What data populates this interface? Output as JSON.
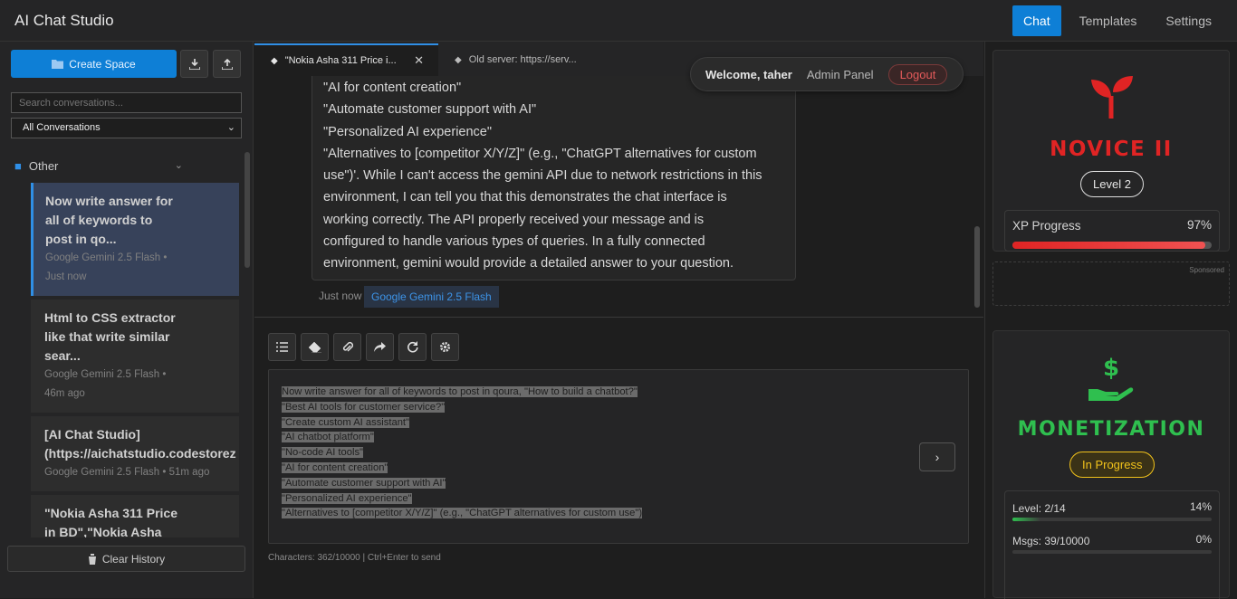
{
  "app": {
    "title": "AI Chat Studio"
  },
  "nav": {
    "chat": "Chat",
    "templates": "Templates",
    "settings": "Settings"
  },
  "sidebar": {
    "create_label": "Create Space",
    "search_placeholder": "Search conversations...",
    "filter_value": "All Conversations",
    "folder": "Other",
    "clear_label": "Clear History",
    "conversations": [
      {
        "title_lines": [
          "Now write answer for",
          "all of keywords to",
          "post in qo..."
        ],
        "model": "Google Gemini 2.5 Flash •",
        "time": "Just now"
      },
      {
        "title_lines": [
          "Html to CSS extractor",
          "like that write similar",
          "sear..."
        ],
        "model": "Google Gemini 2.5 Flash •",
        "time": "46m ago"
      },
      {
        "title_lines": [
          "[AI Chat Studio]",
          "(https://aichatstudio.codestorez"
        ],
        "model": "Google Gemini 2.5 Flash • 51m ago",
        "time": ""
      },
      {
        "title_lines": [
          "\"Nokia Asha 311 Price",
          "in BD\",\"Nokia Asha"
        ],
        "model": "",
        "time": ""
      }
    ]
  },
  "tabs": [
    {
      "label": "\"Nokia Asha 311 Price i..."
    },
    {
      "label": "Old server: https://serv..."
    }
  ],
  "user": {
    "welcome": "Welcome, taher",
    "admin": "Admin Panel",
    "logout": "Logout"
  },
  "message": {
    "lines": [
      "\"AI for content creation\"",
      "\"Automate customer support with AI\"",
      "\"Personalized AI experience\"",
      "\"Alternatives to [competitor X/Y/Z]\" (e.g., \"ChatGPT alternatives for custom",
      "use\")'. While I can't access the gemini API due to network restrictions in this",
      "environment, I can tell you that this demonstrates the chat interface is",
      "working correctly. The API properly received your message and is",
      "configured to handle various types of queries. In a fully connected",
      "environment, gemini would provide a detailed answer to your question."
    ],
    "time": "Just now",
    "model": "Google Gemini 2.5 Flash"
  },
  "composer": {
    "lines": [
      "Now write answer for all of keywords to post in qoura, \"How to build a chatbot?\"",
      "\"Best AI tools for customer service?\"",
      "\"Create custom AI assistant\"",
      "\"AI chatbot platform\"",
      "\"No-code AI tools\"",
      "\"AI for content creation\"",
      "\"Automate customer support with AI\"",
      "\"Personalized AI experience\"",
      "\"Alternatives to [competitor X/Y/Z]\" (e.g., \"ChatGPT alternatives for custom use\")"
    ],
    "char_count": "Characters: 362/10000 | Ctrl+Enter to send"
  },
  "rank_card": {
    "rank": "NOVICE II",
    "level": "Level 2",
    "xp_label": "XP Progress",
    "xp_pct": "97%",
    "xp_value": 0.97,
    "rank_color": "#e02424"
  },
  "ad": {
    "label": "Sponsored"
  },
  "mon_card": {
    "title": "MONETIZATION",
    "status": "In Progress",
    "title_color": "#2fbf4f",
    "status_color": "#f1c21b",
    "stats": [
      {
        "label": "Level: 2/14",
        "pct": "14%",
        "value": 0.14
      },
      {
        "label": "Msgs: 39/10000",
        "pct": "0%",
        "value": 0.0
      }
    ]
  },
  "colors": {
    "accent": "#0e7fd6",
    "link": "#3d94e8",
    "danger": "#e25a5a"
  }
}
